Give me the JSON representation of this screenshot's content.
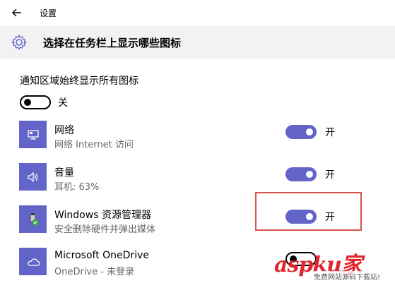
{
  "window": {
    "back_icon": "back-arrow-icon",
    "app_title": "设置"
  },
  "header": {
    "icon": "gear-icon",
    "title": "选择在任务栏上显示哪些图标"
  },
  "master": {
    "label": "通知区域始终显示所有图标",
    "state_text": "关",
    "on": false
  },
  "items": [
    {
      "icon": "network-icon",
      "title": "网络",
      "subtitle": "网络 Internet 访问",
      "state_text": "开",
      "on": true
    },
    {
      "icon": "volume-icon",
      "title": "音量",
      "subtitle": "耳机: 63%",
      "state_text": "开",
      "on": true
    },
    {
      "icon": "usb-safe-remove-icon",
      "title": "Windows 资源管理器",
      "subtitle": "安全删除硬件并弹出媒体",
      "state_text": "开",
      "on": true
    },
    {
      "icon": "onedrive-icon",
      "title": "Microsoft OneDrive",
      "subtitle": "OneDrive - 未登录",
      "state_text": "",
      "on": false
    }
  ],
  "watermark": {
    "main": "asp",
    "k": "k",
    "tail": "u家",
    "sub": "免费网站源码下载站!"
  },
  "colors": {
    "accent": "#6264c8",
    "highlight": "#d9534f",
    "header_bg": "#f2f2f2"
  }
}
